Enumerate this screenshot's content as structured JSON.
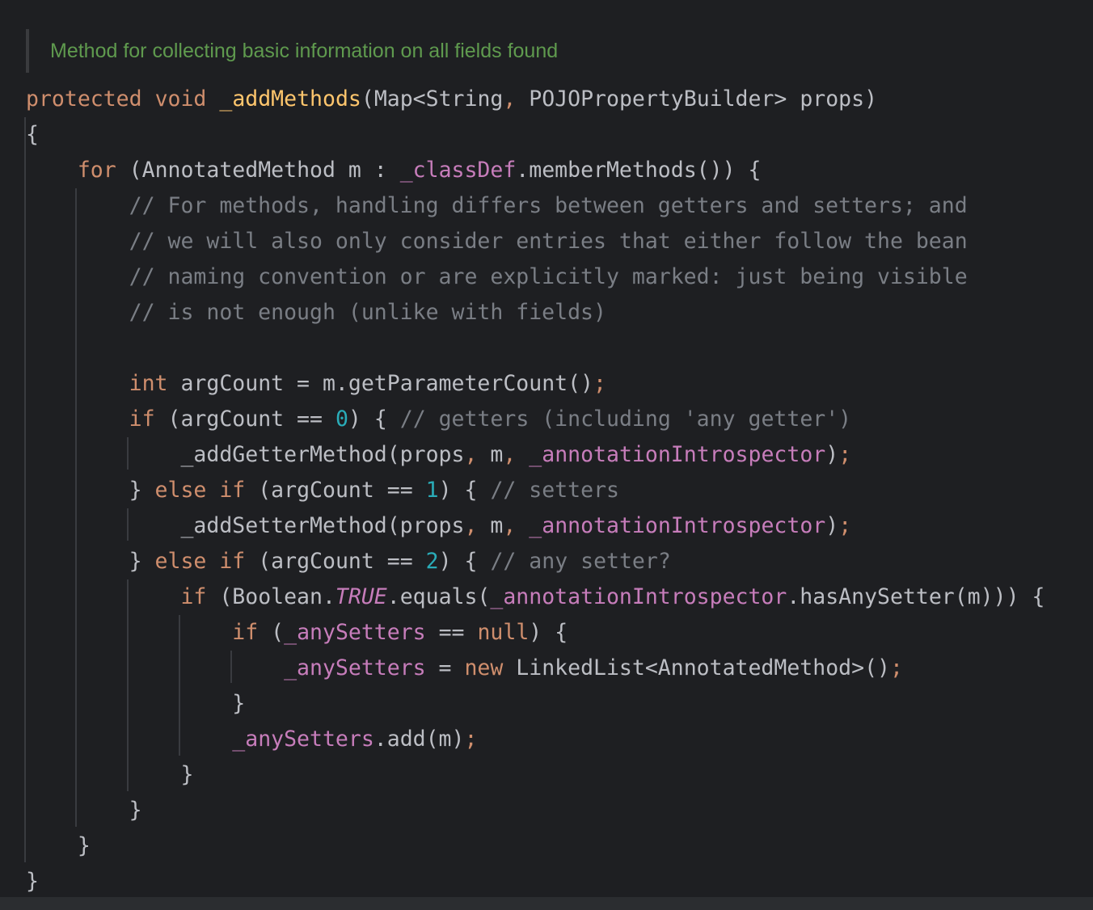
{
  "doc_comment": "Method for collecting basic information on all fields found",
  "lines": [
    [
      [
        "kw",
        "protected"
      ],
      [
        "",
        "·"
      ],
      [
        "kw",
        "void"
      ],
      [
        "",
        "·"
      ],
      [
        "decl",
        "_addMethods"
      ],
      [
        "",
        "(Map<String"
      ],
      [
        "punc",
        ","
      ],
      [
        "",
        "·POJOPropertyBuilder>·props)"
      ]
    ],
    [
      [
        "",
        "{"
      ]
    ],
    [
      [
        "",
        "····"
      ],
      [
        "kw",
        "for"
      ],
      [
        "",
        "·(AnnotatedMethod·m·:·"
      ],
      [
        "field",
        "_classDef"
      ],
      [
        "",
        ".memberMethods())·{"
      ]
    ],
    [
      [
        "",
        "········"
      ],
      [
        "cmt",
        "//·For·methods,·handling·differs·between·getters·and·setters;·and"
      ]
    ],
    [
      [
        "",
        "········"
      ],
      [
        "cmt",
        "//·we·will·also·only·consider·entries·that·either·follow·the·bean"
      ]
    ],
    [
      [
        "",
        "········"
      ],
      [
        "cmt",
        "//·naming·convention·or·are·explicitly·marked:·just·being·visible"
      ]
    ],
    [
      [
        "",
        "········"
      ],
      [
        "cmt",
        "//·is·not·enough·(unlike·with·fields)"
      ]
    ],
    [],
    [
      [
        "",
        "········"
      ],
      [
        "kw",
        "int"
      ],
      [
        "",
        "·argCount·=·m.getParameterCount()"
      ],
      [
        "punc",
        ";"
      ]
    ],
    [
      [
        "",
        "········"
      ],
      [
        "kw",
        "if"
      ],
      [
        "",
        "·(argCount·==·"
      ],
      [
        "num",
        "0"
      ],
      [
        "",
        ")·{·"
      ],
      [
        "cmt",
        "//·getters·(including·'any·getter')"
      ]
    ],
    [
      [
        "",
        "············_addGetterMethod(props"
      ],
      [
        "punc",
        ","
      ],
      [
        "",
        "·m"
      ],
      [
        "punc",
        ","
      ],
      [
        "",
        "·"
      ],
      [
        "field",
        "_annotationIntrospector"
      ],
      [
        "",
        ")"
      ],
      [
        "punc",
        ";"
      ]
    ],
    [
      [
        "",
        "········}·"
      ],
      [
        "kw",
        "else"
      ],
      [
        "",
        "·"
      ],
      [
        "kw",
        "if"
      ],
      [
        "",
        "·(argCount·==·"
      ],
      [
        "num",
        "1"
      ],
      [
        "",
        ")·{·"
      ],
      [
        "cmt",
        "//·setters"
      ]
    ],
    [
      [
        "",
        "············_addSetterMethod(props"
      ],
      [
        "punc",
        ","
      ],
      [
        "",
        "·m"
      ],
      [
        "punc",
        ","
      ],
      [
        "",
        "·"
      ],
      [
        "field",
        "_annotationIntrospector"
      ],
      [
        "",
        ")"
      ],
      [
        "punc",
        ";"
      ]
    ],
    [
      [
        "",
        "········}·"
      ],
      [
        "kw",
        "else"
      ],
      [
        "",
        "·"
      ],
      [
        "kw",
        "if"
      ],
      [
        "",
        "·(argCount·==·"
      ],
      [
        "num",
        "2"
      ],
      [
        "",
        ")·{·"
      ],
      [
        "cmt",
        "//·any·setter?"
      ]
    ],
    [
      [
        "",
        "············"
      ],
      [
        "kw",
        "if"
      ],
      [
        "",
        "·(Boolean."
      ],
      [
        "static",
        "TRUE"
      ],
      [
        "",
        ".equals("
      ],
      [
        "field",
        "_annotationIntrospector"
      ],
      [
        "",
        ".hasAnySetter(m)))·{"
      ]
    ],
    [
      [
        "",
        "················"
      ],
      [
        "kw",
        "if"
      ],
      [
        "",
        "·("
      ],
      [
        "field",
        "_anySetters"
      ],
      [
        "",
        "·==·"
      ],
      [
        "kw",
        "null"
      ],
      [
        "",
        ")·{"
      ]
    ],
    [
      [
        "",
        "····················"
      ],
      [
        "field",
        "_anySetters"
      ],
      [
        "",
        "·=·"
      ],
      [
        "kw",
        "new"
      ],
      [
        "",
        "·LinkedList<AnnotatedMethod>()"
      ],
      [
        "punc",
        ";"
      ]
    ],
    [
      [
        "",
        "················}"
      ]
    ],
    [
      [
        "",
        "················"
      ],
      [
        "field",
        "_anySetters"
      ],
      [
        "",
        ".add(m)"
      ],
      [
        "punc",
        ";"
      ]
    ],
    [
      [
        "",
        "············}"
      ]
    ],
    [
      [
        "",
        "········}"
      ]
    ],
    [
      [
        "",
        "····}"
      ]
    ],
    [
      [
        "",
        "}"
      ]
    ]
  ]
}
